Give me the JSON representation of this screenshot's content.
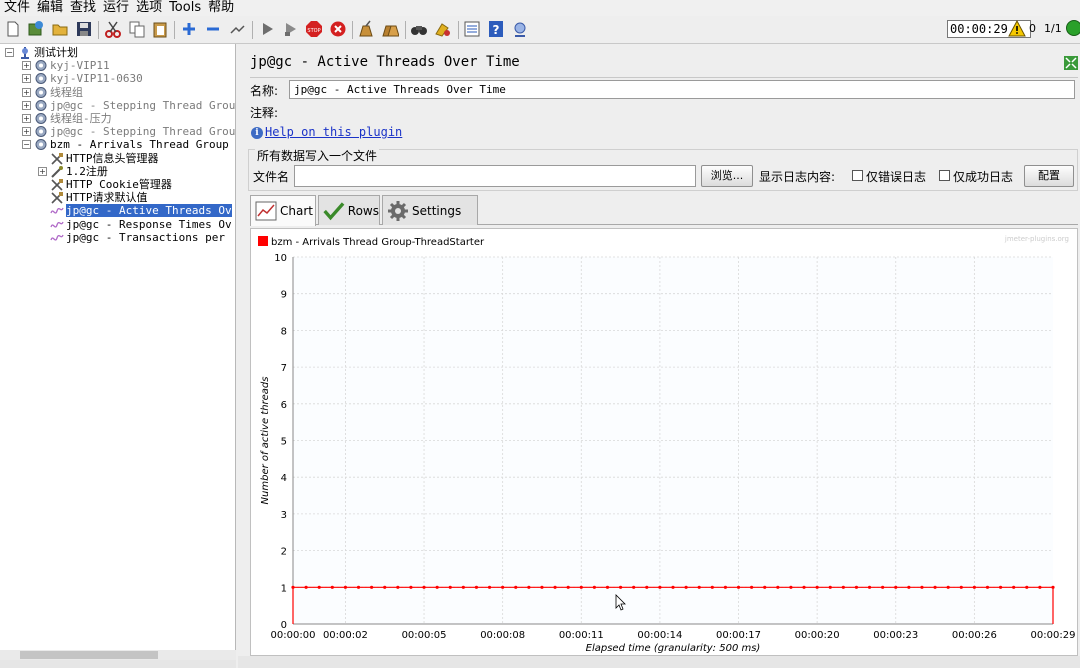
{
  "menu": [
    "文件",
    "编辑",
    "查找",
    "运行",
    "选项",
    "Tools",
    "帮助"
  ],
  "status": {
    "timer": "00:00:29",
    "errors": "0",
    "threads": "1/1"
  },
  "tree": [
    {
      "label": "测试计划",
      "expander": "",
      "gray": false,
      "selected": false
    },
    {
      "label": "kyj-VIP11",
      "expander": "+",
      "gray": true,
      "selected": false
    },
    {
      "label": "kyj-VIP11-0630",
      "expander": "+",
      "gray": true,
      "selected": false
    },
    {
      "label": "线程组",
      "expander": "+",
      "gray": true,
      "selected": false
    },
    {
      "label": "jp@gc - Stepping Thread Grou",
      "expander": "+",
      "gray": true,
      "selected": false
    },
    {
      "label": "线程组-压力",
      "expander": "+",
      "gray": true,
      "selected": false
    },
    {
      "label": "jp@gc - Stepping Thread Grou",
      "expander": "+",
      "gray": true,
      "selected": false
    },
    {
      "label": "bzm - Arrivals Thread Group",
      "expander": "-",
      "gray": false,
      "selected": false
    },
    {
      "label": "HTTP信息头管理器",
      "expander": "",
      "gray": false,
      "selected": false
    },
    {
      "label": "1.2注册",
      "expander": "+",
      "gray": false,
      "selected": false
    },
    {
      "label": "HTTP Cookie管理器",
      "expander": "",
      "gray": false,
      "selected": false
    },
    {
      "label": "HTTP请求默认值",
      "expander": "",
      "gray": false,
      "selected": false
    },
    {
      "label": "jp@gc - Active Threads Ov",
      "expander": "",
      "gray": false,
      "selected": true
    },
    {
      "label": "jp@gc - Response Times Ov",
      "expander": "",
      "gray": false,
      "selected": false
    },
    {
      "label": "jp@gc - Transactions per",
      "expander": "",
      "gray": false,
      "selected": false
    }
  ],
  "panel": {
    "title": "jp@gc - Active Threads Over Time",
    "name_label": "名称:",
    "name_value": "jp@gc - Active Threads Over Time",
    "comment_label": "注释:",
    "help_link": "Help on this plugin",
    "file_group_title": "所有数据写入一个文件",
    "file_label": "文件名",
    "browse_button": "浏览...",
    "log_label": "显示日志内容:",
    "errors_only": "仅错误日志",
    "success_only": "仅成功日志",
    "config_button": "配置",
    "tabs": [
      "Chart",
      "Rows",
      "Settings"
    ]
  },
  "chart_data": {
    "type": "line",
    "watermark": "jmeter-plugins.org",
    "series": [
      {
        "name": "bzm - Arrivals Thread Group-ThreadStarter",
        "color": "#ff0000"
      }
    ],
    "ylabel": "Number of active threads",
    "xlabel": "Elapsed time (granularity: 500 ms)",
    "ylim": [
      0,
      10
    ],
    "y_ticks": [
      "0",
      "1",
      "2",
      "3",
      "4",
      "5",
      "6",
      "7",
      "8",
      "9",
      "10"
    ],
    "x_ticks": [
      "00:00:00",
      "00:00:02",
      "00:00:05",
      "00:00:08",
      "00:00:11",
      "00:00:14",
      "00:00:17",
      "00:00:20",
      "00:00:23",
      "00:00:26",
      "00:00:29"
    ],
    "x_seconds_max": 29,
    "points_count": 59,
    "constant_value": 1
  }
}
